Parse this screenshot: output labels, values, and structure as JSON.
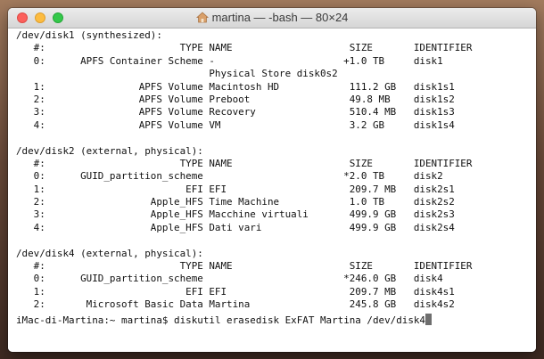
{
  "window": {
    "title": "martina — -bash — 80×24"
  },
  "terminal": {
    "lines": [
      "/dev/disk1 (synthesized):",
      "   #:                       TYPE NAME                    SIZE       IDENTIFIER",
      "   0:      APFS Container Scheme -                      +1.0 TB     disk1",
      "                                 Physical Store disk0s2",
      "   1:                APFS Volume Macintosh HD            111.2 GB   disk1s1",
      "   2:                APFS Volume Preboot                 49.8 MB    disk1s2",
      "   3:                APFS Volume Recovery                510.4 MB   disk1s3",
      "   4:                APFS Volume VM                      3.2 GB     disk1s4",
      "",
      "/dev/disk2 (external, physical):",
      "   #:                       TYPE NAME                    SIZE       IDENTIFIER",
      "   0:      GUID_partition_scheme                        *2.0 TB     disk2",
      "   1:                        EFI EFI                     209.7 MB   disk2s1",
      "   2:                  Apple_HFS Time Machine            1.0 TB     disk2s2",
      "   3:                  Apple_HFS Macchine virtuali       499.9 GB   disk2s3",
      "   4:                  Apple_HFS Dati vari               499.9 GB   disk2s4",
      "",
      "/dev/disk4 (external, physical):",
      "   #:                       TYPE NAME                    SIZE       IDENTIFIER",
      "   0:      GUID_partition_scheme                        *246.0 GB   disk4",
      "   1:                        EFI EFI                     209.7 MB   disk4s1",
      "   2:       Microsoft Basic Data Martina                 245.8 GB   disk4s2"
    ],
    "prompt": "iMac-di-Martina:~ martina$ ",
    "command": "diskutil erasedisk ExFAT Martina /dev/disk4"
  }
}
